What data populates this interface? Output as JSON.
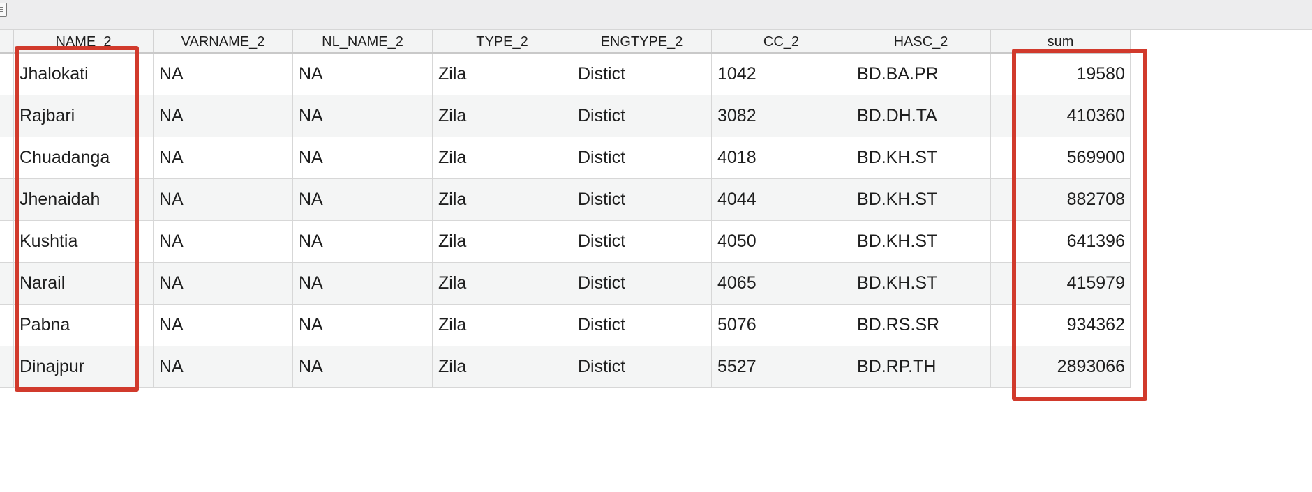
{
  "table": {
    "columns": [
      "NAME_2",
      "VARNAME_2",
      "NL_NAME_2",
      "TYPE_2",
      "ENGTYPE_2",
      "CC_2",
      "HASC_2",
      "sum"
    ],
    "rows": [
      [
        "Jhalokati",
        "NA",
        "NA",
        "Zila",
        "Distict",
        "1042",
        "BD.BA.PR",
        "19580"
      ],
      [
        "Rajbari",
        "NA",
        "NA",
        "Zila",
        "Distict",
        "3082",
        "BD.DH.TA",
        "410360"
      ],
      [
        "Chuadanga",
        "NA",
        "NA",
        "Zila",
        "Distict",
        "4018",
        "BD.KH.ST",
        "569900"
      ],
      [
        "Jhenaidah",
        "NA",
        "NA",
        "Zila",
        "Distict",
        "4044",
        "BD.KH.ST",
        "882708"
      ],
      [
        "Kushtia",
        "NA",
        "NA",
        "Zila",
        "Distict",
        "4050",
        "BD.KH.ST",
        "641396"
      ],
      [
        "Narail",
        "NA",
        "NA",
        "Zila",
        "Distict",
        "4065",
        "BD.KH.ST",
        "415979"
      ],
      [
        "Pabna",
        "NA",
        "NA",
        "Zila",
        "Distict",
        "5076",
        "BD.RS.SR",
        "934362"
      ],
      [
        "Dinajpur",
        "NA",
        "NA",
        "Zila",
        "Distict",
        "5527",
        "BD.RP.TH",
        "2893066"
      ]
    ]
  },
  "toolbar": {
    "icon": "table-icon"
  },
  "annotations": {
    "highlight_color": "#d13a2c",
    "highlighted_columns": [
      "NAME_2",
      "sum"
    ]
  }
}
